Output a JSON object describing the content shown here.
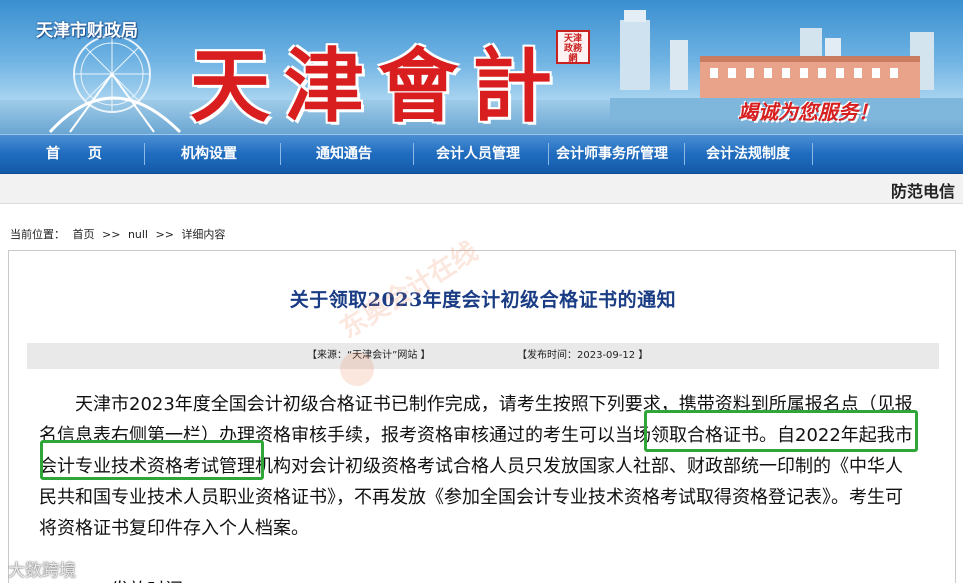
{
  "header": {
    "bureau": "天津市财政局",
    "site_title": "天津會計",
    "seal": "天津 政務 網",
    "slogan": "竭诚为您服务！"
  },
  "nav": {
    "items": [
      {
        "label": "首　　页"
      },
      {
        "label": "机构设置"
      },
      {
        "label": "通知通告"
      },
      {
        "label": "会计人员管理"
      },
      {
        "label": "会计师事务所管理"
      },
      {
        "label": "会计法规制度"
      }
    ]
  },
  "strip": {
    "text": "防范电信"
  },
  "breadcrumb": {
    "label": "当前位置：",
    "items": [
      "首页",
      ">>",
      "null",
      ">>",
      "详细内容"
    ]
  },
  "article": {
    "title": "关于领取2023年度会计初级合格证书的通知",
    "source": "【来源：“天津会计”网站 】",
    "date": "【发布时间：2023-09-12 】",
    "body": "天津市2023年度全国会计初级合格证书已制作完成，请考生按照下列要求，携带资料到所属报名点（见报名信息表右侧第一栏）办理资格审核手续，报考资格审核通过的考生可以当场领取合格证书。自2022年起我市会计专业技术资格考试管理机构对会计初级资格考试合格人员只发放国家人社部、财政部统一印制的《中华人民共和国专业技术人员职业资格证书》，不再发放《参加全国会计专业技术资格考试取得资格登记表》。考生可将资格证书复印件存入个人档案。",
    "next_heading": "一、发放时间"
  },
  "watermark": {
    "text": "东奥会计在线",
    "corner": "大数跨境"
  },
  "colors": {
    "nav": "#1f6cbf",
    "title": "#1a3c84",
    "brand_red": "#d81e1e",
    "highlight": "#2fa53a",
    "meta_bg": "#e9e9e9"
  }
}
